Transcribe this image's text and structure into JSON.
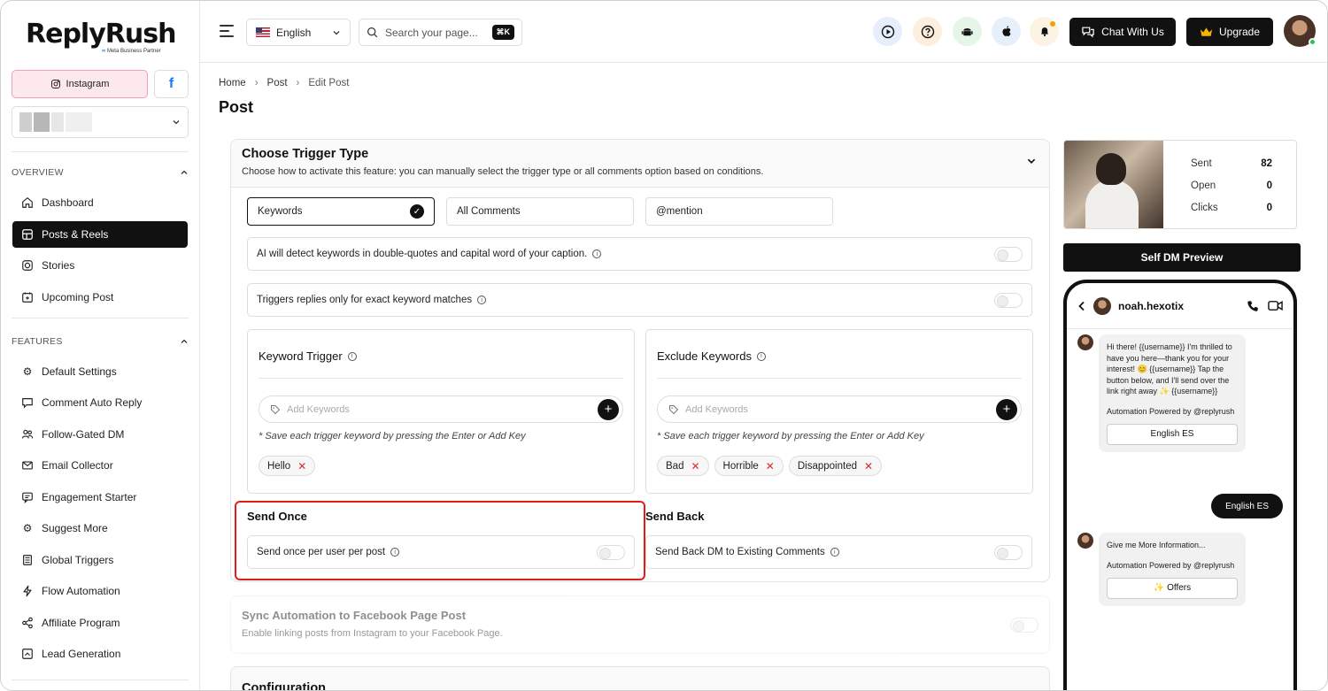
{
  "brand": {
    "name": "ReplyRush",
    "subtitle": "Meta Business Partner"
  },
  "sidebar": {
    "instagram_label": "Instagram",
    "facebook_label": "f",
    "overview_header": "OVERVIEW",
    "overview_items": [
      {
        "label": "Dashboard",
        "icon": "home-icon"
      },
      {
        "label": "Posts & Reels",
        "icon": "posts-icon",
        "active": true
      },
      {
        "label": "Stories",
        "icon": "stories-icon"
      },
      {
        "label": "Upcoming Post",
        "icon": "calendar-icon"
      }
    ],
    "features_header": "FEATURES",
    "feature_items": [
      {
        "label": "Default Settings",
        "icon": "gear-icon"
      },
      {
        "label": "Comment Auto Reply",
        "icon": "comment-icon"
      },
      {
        "label": "Follow-Gated DM",
        "icon": "users-icon"
      },
      {
        "label": "Email Collector",
        "icon": "mail-icon"
      },
      {
        "label": "Engagement Starter",
        "icon": "chat-icon"
      },
      {
        "label": "Suggest More",
        "icon": "cog-sparkle-icon"
      },
      {
        "label": "Global Triggers",
        "icon": "list-icon"
      },
      {
        "label": "Flow Automation",
        "icon": "bolt-icon"
      },
      {
        "label": "Affiliate Program",
        "icon": "share-icon"
      },
      {
        "label": "Lead Generation",
        "icon": "lead-icon"
      }
    ]
  },
  "header": {
    "language": "English",
    "search_placeholder": "Search your page...",
    "shortcut": "⌘K",
    "chat_label": "Chat With Us",
    "upgrade_label": "Upgrade",
    "colors": {
      "play": "#e6eefc",
      "help": "#fdeede",
      "android": "#e5f6e8",
      "apple": "#e6f0fb",
      "bell": "#fdf3e2"
    }
  },
  "breadcrumb": {
    "home": "Home",
    "post": "Post",
    "current": "Edit Post"
  },
  "page_title": "Post",
  "trigger": {
    "title": "Choose Trigger Type",
    "description": "Choose how to activate this feature: you can manually select the trigger type or all comments option based on conditions.",
    "options": [
      "Keywords",
      "All Comments",
      "@mention"
    ],
    "ai_detect": "AI will detect keywords in double-quotes and capital word of your caption.",
    "exact_match": "Triggers replies only for exact keyword matches",
    "keyword_trigger_title": "Keyword Trigger",
    "exclude_title": "Exclude Keywords",
    "add_placeholder": "Add Keywords",
    "hint": "* Save each trigger keyword by pressing the Enter or Add Key",
    "keyword_tags": [
      "Hello"
    ],
    "exclude_tags": [
      "Bad",
      "Horrible",
      "Disappointed"
    ],
    "send_once_title": "Send Once",
    "send_once_label": "Send once per user per post",
    "send_back_title": "Send Back",
    "send_back_label": "Send Back DM to Existing Comments"
  },
  "sync": {
    "title": "Sync Automation to Facebook Page Post",
    "description": "Enable linking posts from Instagram to your Facebook Page."
  },
  "config": {
    "title": "Configuration"
  },
  "stats": {
    "sent_label": "Sent",
    "sent": "82",
    "open_label": "Open",
    "open": "0",
    "clicks_label": "Clicks",
    "clicks": "0"
  },
  "preview": {
    "button": "Self DM Preview",
    "username": "noah.hexotix",
    "msg1": "Hi there! {{username}} I'm thrilled to have you here—thank you for your interest! 😊 {{username}} Tap the button below, and I'll send over the link right away ✨ {{username}}",
    "powered": "Automation Powered by @replyrush",
    "msg1_button": "English ES",
    "sent_reply": "English ES",
    "msg2": "Give me More Information...",
    "msg2_button": "✨ Offers"
  }
}
